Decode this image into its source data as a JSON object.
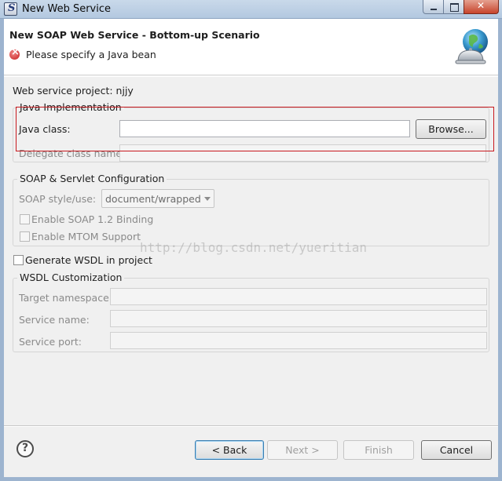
{
  "window": {
    "title": "New Web Service",
    "icon": "eclipse-s-icon"
  },
  "banner": {
    "title": "New SOAP Web Service - Bottom-up Scenario",
    "message": "Please specify a Java bean",
    "message_icon": "error-icon",
    "image_icon": "globe-bell-icon"
  },
  "project": {
    "label": "Web service project: njjy"
  },
  "java_impl": {
    "group_title": "Java Implementation",
    "java_class_label": "Java class:",
    "java_class_value": "",
    "browse_label": "Browse...",
    "delegate_label": "Delegate class name:",
    "delegate_value": ""
  },
  "soap": {
    "group_title": "SOAP & Servlet Configuration",
    "style_label": "SOAP style/use:",
    "style_value": "document/wrapped",
    "enable_soap12": "Enable SOAP 1.2 Binding",
    "enable_mtom": "Enable MTOM Support"
  },
  "generate_wsdl": {
    "label": "Generate WSDL in project"
  },
  "wsdl": {
    "group_title": "WSDL Customization",
    "target_ns_label": "Target namespace:",
    "service_name_label": "Service name:",
    "service_port_label": "Service port:"
  },
  "watermark": "http://blog.csdn.net/yueritian",
  "footer": {
    "back": "< Back",
    "next": "Next >",
    "finish": "Finish",
    "cancel": "Cancel"
  },
  "colors": {
    "highlight": "#c8191e",
    "error": "#c81e1e"
  }
}
